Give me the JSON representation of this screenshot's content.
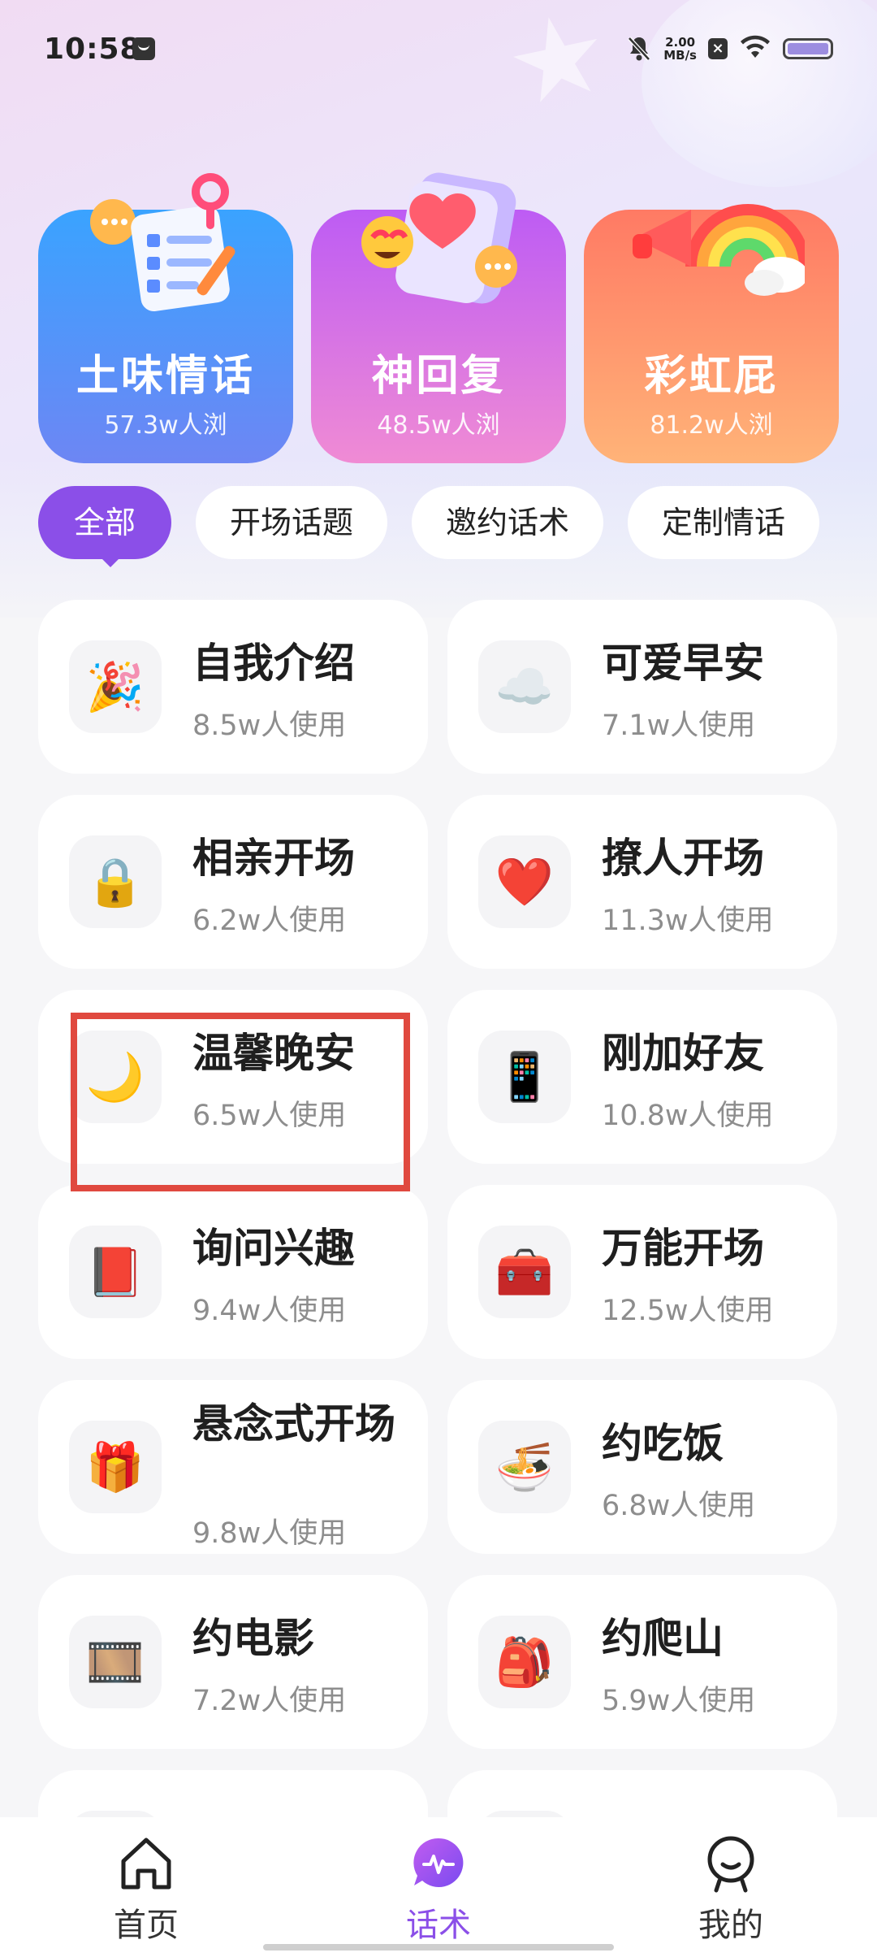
{
  "status_bar": {
    "time": "10:58",
    "net_speed_value": "2.00",
    "net_speed_unit": "MB/s",
    "close_glyph": "×"
  },
  "feature_cards": [
    {
      "title": "土味情话",
      "subtitle": "57.3w人浏",
      "icon": "checklist-icon"
    },
    {
      "title": "神回复",
      "subtitle": "48.5w人浏",
      "icon": "heart-chat-icon"
    },
    {
      "title": "彩虹屁",
      "subtitle": "81.2w人浏",
      "icon": "rainbow-megaphone-icon"
    }
  ],
  "tabs": [
    "全部",
    "开场话题",
    "邀约话术",
    "定制情话"
  ],
  "active_tab": "全部",
  "tiles": [
    {
      "title": "自我介绍",
      "usage": "8.5w人使用",
      "icon": "🎉"
    },
    {
      "title": "可爱早安",
      "usage": "7.1w人使用",
      "icon": "☁️"
    },
    {
      "title": "相亲开场",
      "usage": "6.2w人使用",
      "icon": "🔒"
    },
    {
      "title": "撩人开场",
      "usage": "11.3w人使用",
      "icon": "❤️"
    },
    {
      "title": "温馨晚安",
      "usage": "6.5w人使用",
      "icon": "🌙"
    },
    {
      "title": "刚加好友",
      "usage": "10.8w人使用",
      "icon": "📱"
    },
    {
      "title": "询问兴趣",
      "usage": "9.4w人使用",
      "icon": "📕"
    },
    {
      "title": "万能开场",
      "usage": "12.5w人使用",
      "icon": "🧰"
    },
    {
      "title": "悬念式开场",
      "usage": "9.8w人使用",
      "icon": "🎁"
    },
    {
      "title": "约吃饭",
      "usage": "6.8w人使用",
      "icon": "🍜"
    },
    {
      "title": "约电影",
      "usage": "7.2w人使用",
      "icon": "🎞️"
    },
    {
      "title": "约爬山",
      "usage": "5.9w人使用",
      "icon": "🎒"
    },
    {
      "title": "",
      "usage": "",
      "icon": ""
    },
    {
      "title": "",
      "usage": "",
      "icon": ""
    }
  ],
  "nav": {
    "home": "首页",
    "talk": "话术",
    "me": "我的",
    "active": "话术"
  },
  "colors": {
    "accent": "#8b4fe8",
    "highlight": "#e0493f"
  }
}
